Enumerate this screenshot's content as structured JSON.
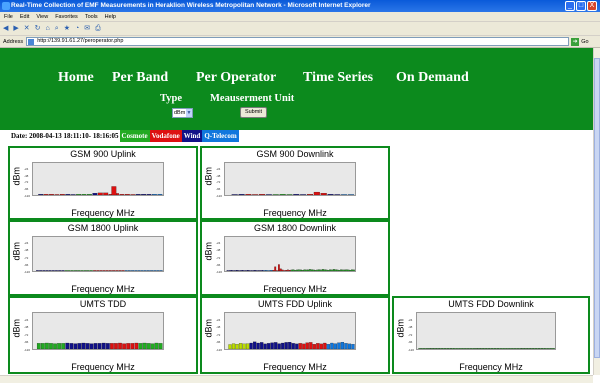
{
  "window": {
    "title": "Real-Time Collection of EMF Measurements in Heraklion Wireless Metropolitan Network - Microsoft Internet Explorer",
    "minimize": "_",
    "maximize": "□",
    "close": "X"
  },
  "menu": [
    "File",
    "Edit",
    "View",
    "Favorites",
    "Tools",
    "Help"
  ],
  "address": {
    "label": "Address",
    "url": "http://139.91.61.27/peroperator.php",
    "go": "Go"
  },
  "nav": [
    "Home",
    "Per Band",
    "Per Operator",
    "Time Series",
    "On Demand"
  ],
  "form": {
    "type_label": "Type",
    "type_value": "dBm",
    "unit_label": "Meauserment Unit",
    "submit": "Submit"
  },
  "date": "Date: 2008-04-13 18:11:10- 18:16:05",
  "legend": [
    {
      "name": "Cosmote",
      "color": "#22aa22"
    },
    {
      "name": "Vodafone",
      "color": "#dd1111"
    },
    {
      "name": "Wind",
      "color": "#111188"
    },
    {
      "name": "Q-Telecom",
      "color": "#1177dd"
    }
  ],
  "axis": {
    "ylabel": "dBm",
    "xlabel": "Frequency MHz",
    "yticks": [
      "-24",
      "-48",
      "-72",
      "-96",
      "-120"
    ]
  },
  "chart_data": [
    {
      "type": "bar",
      "title": "GSM 900 Uplink",
      "ylim": [
        -120,
        0
      ],
      "series": [
        {
          "name": "Cosmote",
          "color": "#22aa22",
          "x": [
            8,
            9,
            10
          ],
          "values": [
            -117,
            -117,
            -117
          ]
        },
        {
          "name": "Vodafone",
          "color": "#dd1111",
          "x": [
            2,
            3,
            4,
            5,
            12,
            13,
            14,
            15,
            16,
            17,
            18
          ],
          "values": [
            -117,
            -117,
            -118,
            -117,
            -112,
            -112,
            -117,
            -114,
            -117,
            -117,
            -118
          ]
        },
        {
          "name": "Wind",
          "color": "#111188",
          "x": [
            1,
            6,
            7,
            11,
            19,
            20,
            21
          ],
          "values": [
            -117,
            -117,
            -118,
            -113,
            -117,
            -117,
            -117
          ]
        },
        {
          "name": "Q-Telecom",
          "color": "#1177dd",
          "x": [
            22,
            23
          ],
          "values": [
            -117,
            -117
          ]
        },
        {
          "name": "Vodafone",
          "color": "#dd1111",
          "x": [
            14.5
          ],
          "values": [
            -88
          ]
        }
      ]
    },
    {
      "type": "bar",
      "title": "GSM 900 Downlink",
      "ylim": [
        -120,
        0
      ],
      "series": [
        {
          "name": "Cosmote",
          "color": "#22aa22",
          "x": [
            7,
            8,
            9
          ],
          "values": [
            -118,
            -117,
            -118
          ]
        },
        {
          "name": "Vodafone",
          "color": "#dd1111",
          "x": [
            3,
            4,
            5,
            12,
            13,
            14
          ],
          "values": [
            -117,
            -118,
            -117,
            -117,
            -109,
            -113
          ]
        },
        {
          "name": "Wind",
          "color": "#111188",
          "x": [
            1,
            2,
            6,
            10,
            11,
            15,
            16
          ],
          "values": [
            -118,
            -117,
            -118,
            -117,
            -118,
            -117,
            -118
          ]
        },
        {
          "name": "Q-Telecom",
          "color": "#1177dd",
          "x": [
            17,
            18
          ],
          "values": [
            -118,
            -118
          ]
        }
      ]
    },
    {
      "type": "bar",
      "title": "GSM 1800 Uplink",
      "ylim": [
        -120,
        0
      ],
      "series": [
        {
          "name": "Cosmote",
          "color": "#22aa22",
          "x": [
            10,
            11,
            12,
            13,
            14,
            15,
            16,
            17,
            18
          ],
          "values": [
            -118,
            -118,
            -118,
            -118,
            -118,
            -118,
            -118,
            -118,
            -118
          ]
        },
        {
          "name": "Vodafone",
          "color": "#dd1111",
          "x": [
            19,
            20,
            21,
            22,
            23,
            24,
            25,
            26,
            27,
            28
          ],
          "values": [
            -118,
            -118,
            -118,
            -118,
            -118,
            -118,
            -118,
            -118,
            -118,
            -118
          ]
        },
        {
          "name": "Wind",
          "color": "#111188",
          "x": [
            1,
            2,
            3,
            4,
            5,
            6,
            7,
            8,
            9
          ],
          "values": [
            -118,
            -118,
            -118,
            -118,
            -118,
            -118,
            -118,
            -118,
            -118
          ]
        },
        {
          "name": "Q-Telecom",
          "color": "#1177dd",
          "x": [
            29,
            30,
            31,
            32,
            33,
            34,
            35,
            36,
            37,
            38,
            39,
            40
          ],
          "values": [
            -118,
            -118,
            -118,
            -118,
            -118,
            -118,
            -118,
            -118,
            -118,
            -118,
            -118,
            -118
          ]
        }
      ]
    },
    {
      "type": "bar",
      "title": "GSM 1800 Downlink",
      "ylim": [
        -120,
        0
      ],
      "series": [
        {
          "name": "Wind",
          "color": "#111188",
          "x": [
            1,
            2,
            3,
            4,
            5,
            6,
            7,
            8,
            9,
            10,
            11,
            12,
            13,
            14,
            15,
            16,
            17,
            18,
            19,
            20
          ],
          "values": [
            -118,
            -118,
            -117,
            -118,
            -118,
            -117,
            -118,
            -118,
            -117,
            -118,
            -118,
            -117,
            -118,
            -118,
            -118,
            -117,
            -118,
            -118,
            -118,
            -117
          ]
        },
        {
          "name": "Q-Telecom",
          "color": "#1177dd",
          "x": [
            21,
            22,
            23,
            24,
            25
          ],
          "values": [
            -118,
            -117,
            -118,
            -118,
            -117
          ]
        },
        {
          "name": "Vodafone",
          "color": "#dd1111",
          "x": [
            26,
            27,
            28,
            29,
            30,
            31,
            32,
            33,
            34,
            35
          ],
          "values": [
            -117,
            -105,
            -118,
            -117,
            -112,
            -116,
            -118,
            -117,
            -116,
            -117
          ]
        },
        {
          "name": "Cosmote",
          "color": "#22aa22",
          "x": [
            36,
            37,
            38,
            39,
            40,
            41,
            42,
            43,
            44,
            45,
            46,
            47,
            48,
            49,
            50,
            51,
            52,
            53,
            54,
            55,
            56,
            57,
            58,
            59,
            60,
            61,
            62,
            63,
            64,
            65,
            66,
            67,
            68,
            69,
            70
          ],
          "values": [
            -116,
            -115,
            -117,
            -116,
            -115,
            -116,
            -117,
            -115,
            -116,
            -116,
            -114,
            -115,
            -116,
            -117,
            -116,
            -115,
            -116,
            -114,
            -115,
            -116,
            -117,
            -115,
            -116,
            -114,
            -115,
            -116,
            -117,
            -115,
            -116,
            -116,
            -115,
            -116,
            -117,
            -115,
            -116
          ]
        },
        {
          "name": "Vodafone",
          "color": "#dd1111",
          "x": [
            29
          ],
          "values": [
            -97
          ]
        }
      ]
    },
    {
      "type": "bar",
      "title": "UMTS TDD",
      "ylim": [
        -120,
        0
      ],
      "series": [
        {
          "name": "Cosmote",
          "color": "#22aa22",
          "x": [
            1,
            2,
            3,
            4,
            5,
            6,
            7
          ],
          "values": [
            -101,
            -101,
            -100,
            -101,
            -102,
            -101,
            -101
          ]
        },
        {
          "name": "Wind",
          "color": "#111188",
          "x": [
            8,
            9,
            10,
            11,
            12,
            13,
            14,
            15,
            16,
            17,
            18
          ],
          "values": [
            -100,
            -101,
            -102,
            -101,
            -100,
            -101,
            -102,
            -101,
            -101,
            -100,
            -101
          ]
        },
        {
          "name": "Vodafone",
          "color": "#dd1111",
          "x": [
            19,
            20,
            21,
            22,
            23,
            24,
            25
          ],
          "values": [
            -101,
            -101,
            -100,
            -102,
            -101,
            -101,
            -100
          ]
        },
        {
          "name": "Cosmote",
          "color": "#22aa22",
          "x": [
            26,
            27,
            28,
            29,
            30,
            31
          ],
          "values": [
            -101,
            -100,
            -101,
            -102,
            -100,
            -101
          ]
        }
      ]
    },
    {
      "type": "bar",
      "title": "UMTS FDD Uplink",
      "ylim": [
        -120,
        0
      ],
      "series": [
        {
          "name": "Cosmote",
          "color": "#bbdd00",
          "x": [
            1,
            2,
            3,
            4,
            5,
            6
          ],
          "values": [
            -105,
            -102,
            -104,
            -101,
            -103,
            -102
          ]
        },
        {
          "name": "Wind",
          "color": "#111188",
          "x": [
            7,
            8,
            9,
            10,
            11,
            12,
            13,
            14,
            15,
            16,
            17,
            18,
            19,
            20
          ],
          "values": [
            -100,
            -96,
            -100,
            -98,
            -103,
            -101,
            -99,
            -98,
            -102,
            -100,
            -98,
            -97,
            -101,
            -103
          ]
        },
        {
          "name": "Vodafone",
          "color": "#dd1111",
          "x": [
            21,
            22,
            23,
            24,
            25,
            26,
            27,
            28
          ],
          "values": [
            -101,
            -103,
            -99,
            -98,
            -104,
            -101,
            -103,
            -100
          ]
        },
        {
          "name": "Q-Telecom",
          "color": "#1177dd",
          "x": [
            29,
            30,
            31,
            32,
            33,
            34,
            35,
            36
          ],
          "values": [
            -104,
            -100,
            -102,
            -99,
            -97,
            -101,
            -103,
            -104
          ]
        }
      ]
    },
    {
      "type": "bar",
      "title": "UMTS FDD Downlink",
      "ylim": [
        -120,
        0
      ],
      "series": [
        {
          "name": "Cosmote",
          "color": "#22aa22",
          "x": [
            1,
            2,
            3,
            4,
            5,
            6,
            7,
            8,
            9,
            10,
            11,
            12,
            13,
            14,
            15,
            16,
            17,
            18,
            19,
            20,
            21,
            22,
            23,
            24,
            25,
            26,
            27,
            28,
            29,
            30,
            31,
            32,
            33,
            34,
            35,
            36,
            37,
            38,
            39,
            40,
            41,
            42,
            43,
            44,
            45,
            46,
            47,
            48,
            49,
            50,
            51,
            52,
            53,
            54,
            55,
            56,
            57,
            58,
            59,
            60,
            61,
            62,
            63,
            64,
            65,
            66,
            67,
            68,
            69,
            70,
            71,
            72,
            73,
            74,
            75,
            76,
            77,
            78,
            79,
            80,
            81,
            82,
            83,
            84,
            85,
            86,
            87,
            88,
            89,
            90
          ],
          "values": [
            -118,
            -118,
            -118,
            -118,
            -118,
            -118,
            -118,
            -118,
            -118,
            -118,
            -118,
            -118,
            -118,
            -118,
            -118,
            -118,
            -118,
            -118,
            -118,
            -118,
            -118,
            -118,
            -118,
            -118,
            -118,
            -118,
            -118,
            -118,
            -118,
            -118,
            -118,
            -118,
            -118,
            -118,
            -118,
            -118,
            -118,
            -118,
            -118,
            -118,
            -118,
            -118,
            -118,
            -118,
            -118,
            -118,
            -118,
            -118,
            -118,
            -118,
            -118,
            -118,
            -118,
            -118,
            -118,
            -118,
            -118,
            -118,
            -118,
            -118,
            -118,
            -118,
            -118,
            -118,
            -118,
            -118,
            -118,
            -118,
            -118,
            -118,
            -118,
            -118,
            -118,
            -118,
            -118,
            -118,
            -118,
            -118,
            -118,
            -118,
            -118,
            -118,
            -118,
            -118,
            -118,
            -118,
            -118,
            -118,
            -118,
            -118
          ]
        }
      ]
    }
  ]
}
